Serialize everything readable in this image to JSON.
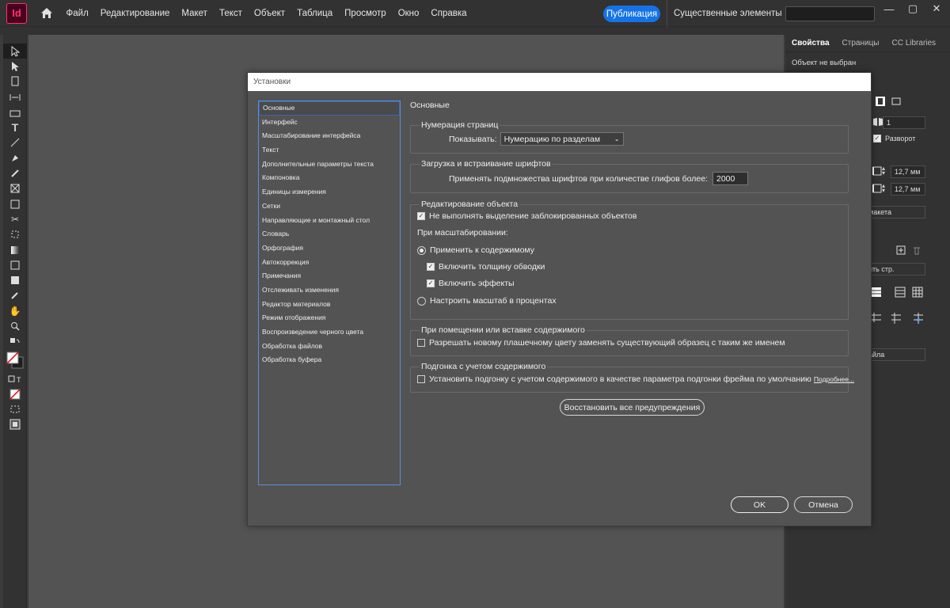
{
  "app": {
    "logo": "Id"
  },
  "menu": [
    "Файл",
    "Редактирование",
    "Макет",
    "Текст",
    "Объект",
    "Таблица",
    "Просмотр",
    "Окно",
    "Справка"
  ],
  "publish_label": "Публикация",
  "workspace": {
    "label": "Существенные элементы",
    "chevron": "⌄"
  },
  "window_controls": {
    "minimize": "—",
    "maximize": "▢",
    "close": "✕"
  },
  "right_panel": {
    "tabs": [
      "Свойства",
      "Страницы",
      "CC Libraries"
    ],
    "status": "Объект не выбран",
    "pages_value": "1",
    "facing_label": "Разворот",
    "margin_top": "12,7 мм",
    "margin_bottom": "12,7 мм",
    "layout_button": "макета",
    "pages_button": "ить стр.",
    "file_button": "айла"
  },
  "dialog": {
    "title": "Установки",
    "categories": [
      "Основные",
      "Интерфейс",
      "Масштабирование интерфейса",
      "Текст",
      "Дополнительные параметры текста",
      "Компоновка",
      "Единицы измерения",
      "Сетки",
      "Направляющие и монтажный стол",
      "Словарь",
      "Орфография",
      "Автокоррекция",
      "Примечания",
      "Отслеживать изменения",
      "Редактор материалов",
      "Режим отображения",
      "Воспроизведение черного цвета",
      "Обработка файлов",
      "Обработка буфера"
    ],
    "selected_category": 0,
    "section_title": "Основные",
    "page_numbering": {
      "group": "Нумерация страниц",
      "show_label": "Показывать:",
      "show_value": "Нумерацию по разделам"
    },
    "fonts": {
      "group": "Загрузка и встраивание шрифтов",
      "subset_label": "Применять подмножества шрифтов при количестве глифов более:",
      "subset_value": "2000"
    },
    "object_editing": {
      "group": "Редактирование объекта",
      "no_select_locked": "Не выполнять выделение заблокированных объектов",
      "when_scaling": "При масштабировании:",
      "apply_to_content": "Применить к содержимому",
      "include_stroke": "Включить толщину обводки",
      "include_effects": "Включить эффекты",
      "scale_percent": "Настроить масштаб в процентах"
    },
    "placing": {
      "group": "При помещении или вставке содержимого",
      "allow_swatch": "Разрешать новому плашечному цвету заменять существующий образец с таким же именем"
    },
    "content_aware": {
      "group": "Подгонка с учетом содержимого",
      "default_fit": "Установить подгонку с учетом содержимого в качестве параметра подгонки фрейма по умолчанию",
      "more_link": "Подробнее..."
    },
    "reset_warnings": "Восстановить все предупреждения",
    "ok": "OK",
    "cancel": "Отмена"
  }
}
